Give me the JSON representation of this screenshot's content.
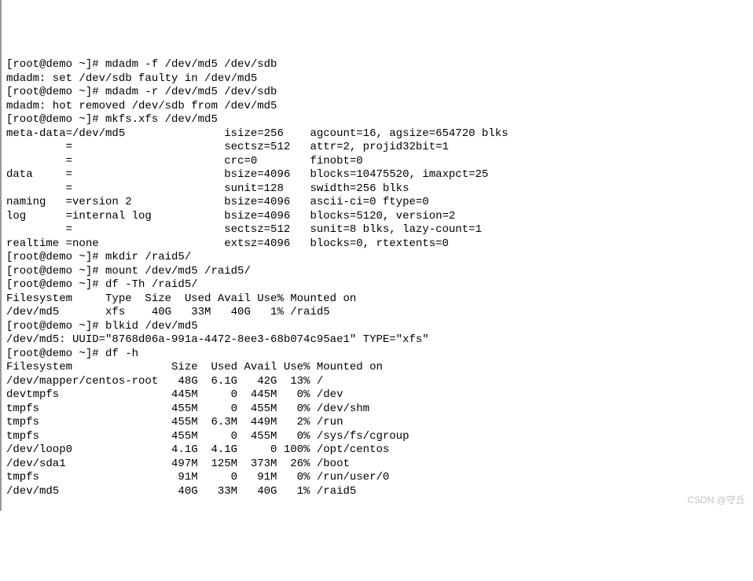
{
  "lines": [
    "[root@demo ~]# mdadm -f /dev/md5 /dev/sdb",
    "mdadm: set /dev/sdb faulty in /dev/md5",
    "[root@demo ~]# mdadm -r /dev/md5 /dev/sdb",
    "mdadm: hot removed /dev/sdb from /dev/md5",
    "[root@demo ~]# mkfs.xfs /dev/md5",
    "meta-data=/dev/md5               isize=256    agcount=16, agsize=654720 blks",
    "         =                       sectsz=512   attr=2, projid32bit=1",
    "         =                       crc=0        finobt=0",
    "data     =                       bsize=4096   blocks=10475520, imaxpct=25",
    "         =                       sunit=128    swidth=256 blks",
    "naming   =version 2              bsize=4096   ascii-ci=0 ftype=0",
    "log      =internal log           bsize=4096   blocks=5120, version=2",
    "         =                       sectsz=512   sunit=8 blks, lazy-count=1",
    "realtime =none                   extsz=4096   blocks=0, rtextents=0",
    "[root@demo ~]# mkdir /raid5/",
    "[root@demo ~]# mount /dev/md5 /raid5/",
    "[root@demo ~]# df -Th /raid5/",
    "Filesystem     Type  Size  Used Avail Use% Mounted on",
    "/dev/md5       xfs    40G   33M   40G   1% /raid5",
    "[root@demo ~]# blkid /dev/md5",
    "/dev/md5: UUID=\"8768d06a-991a-4472-8ee3-68b074c95ae1\" TYPE=\"xfs\"",
    "[root@demo ~]# df -h",
    "Filesystem               Size  Used Avail Use% Mounted on",
    "/dev/mapper/centos-root   48G  6.1G   42G  13% /",
    "devtmpfs                 445M     0  445M   0% /dev",
    "tmpfs                    455M     0  455M   0% /dev/shm",
    "tmpfs                    455M  6.3M  449M   2% /run",
    "tmpfs                    455M     0  455M   0% /sys/fs/cgroup",
    "/dev/loop0               4.1G  4.1G     0 100% /opt/centos",
    "/dev/sda1                497M  125M  373M  26% /boot",
    "tmpfs                     91M     0   91M   0% /run/user/0",
    "/dev/md5                  40G   33M   40G   1% /raid5"
  ],
  "watermark": "CSDN @守丘"
}
